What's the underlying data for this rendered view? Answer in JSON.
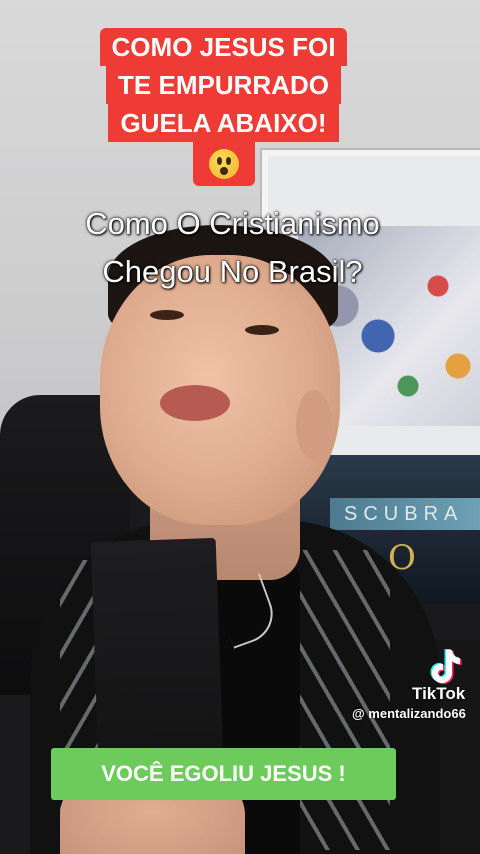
{
  "top_caption": {
    "lines": [
      "COMO JESUS FOI",
      "TE EMPURRADO",
      "GUELA ABAIXO!"
    ],
    "emoji": "😮",
    "background_color": "#ef3b36"
  },
  "subtitle": {
    "lines": [
      "Como O Cristianismo",
      "Chegou No Brasil?"
    ]
  },
  "watermark": {
    "logo_icon": "tiktok-logo-icon",
    "brand": "TikTok",
    "handle": "@ mentalizando66"
  },
  "bottom_banner": {
    "text": "VOCÊ EGOLIU JESUS !",
    "background_color": "#6ccb5a"
  },
  "scene": {
    "tv_banner_text": "SCUBRA",
    "tv_gold_text": "O"
  }
}
